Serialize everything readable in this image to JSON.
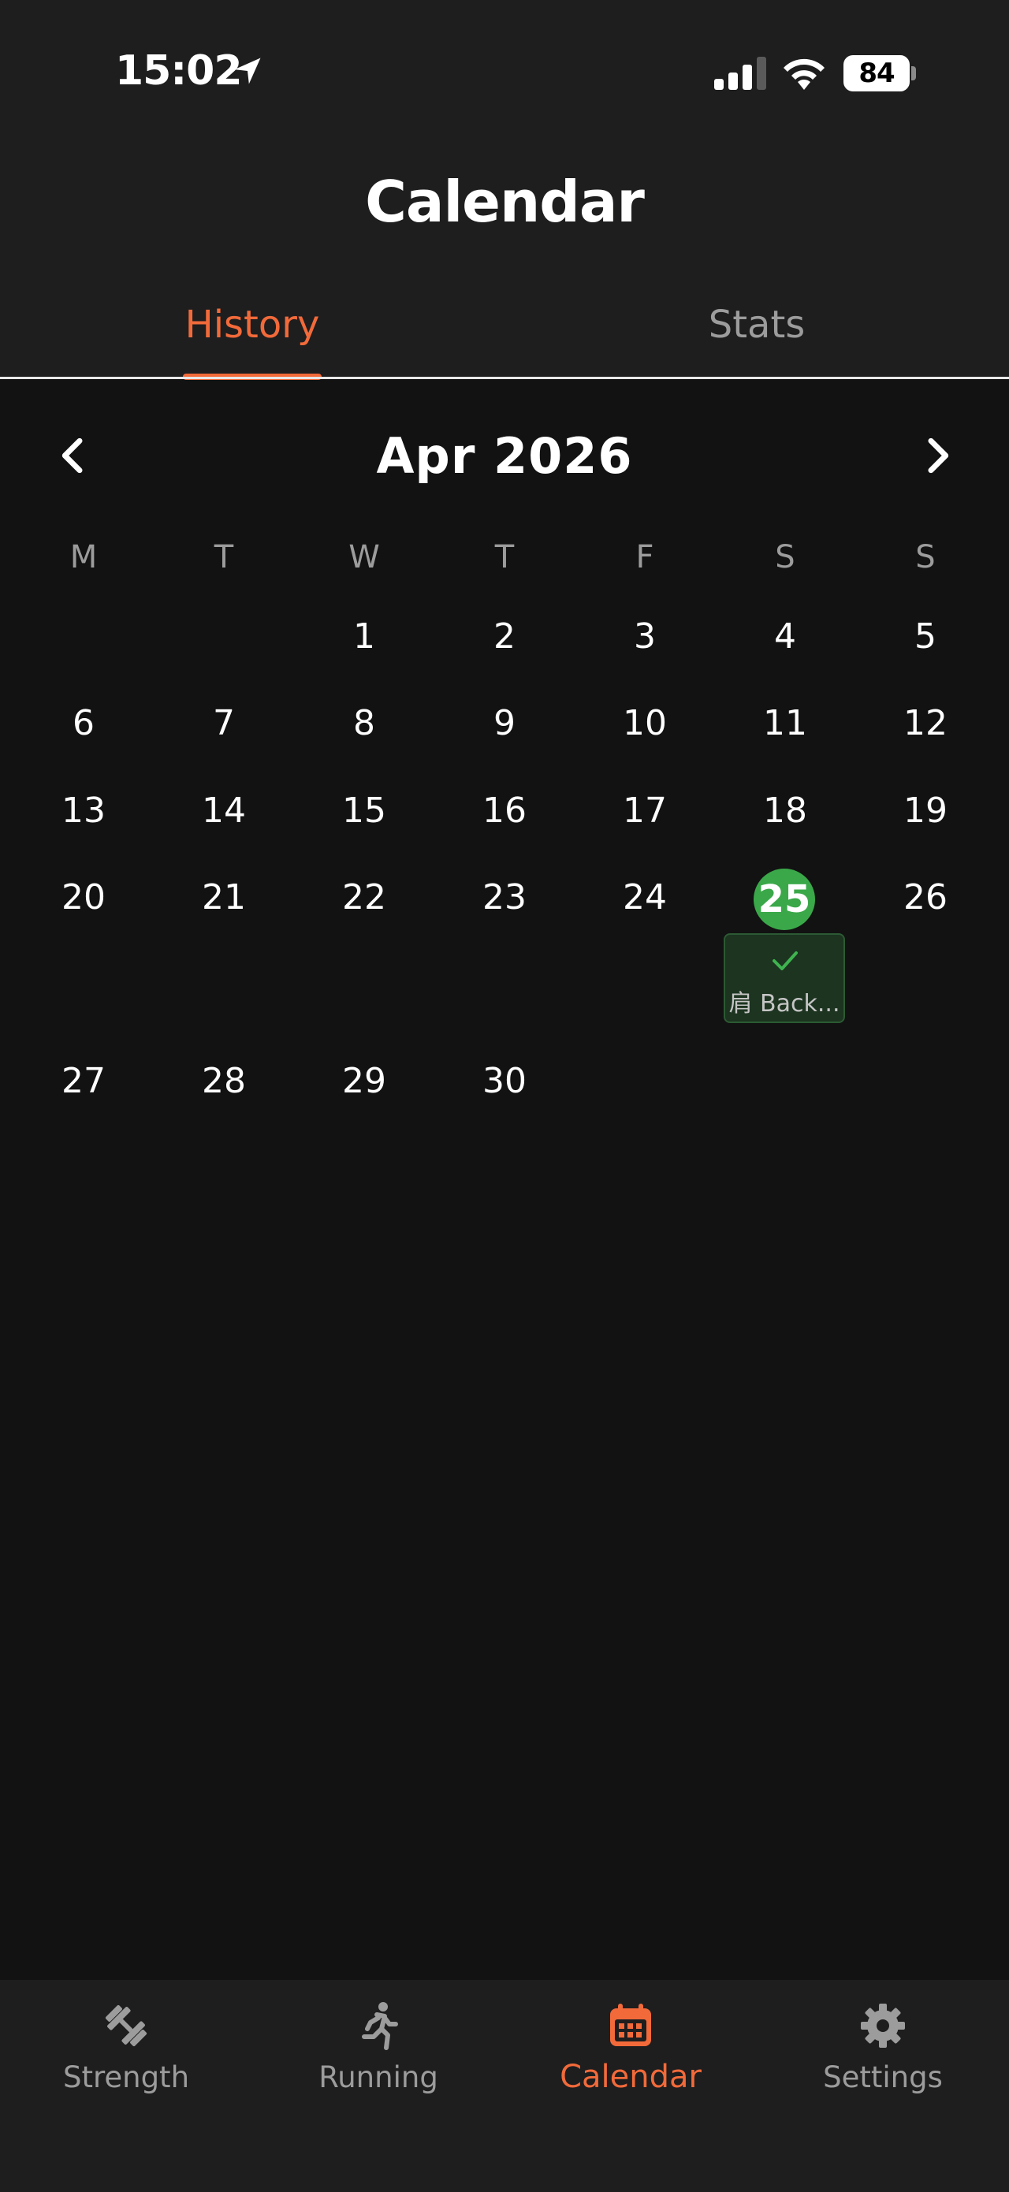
{
  "status_bar": {
    "time": "15:02",
    "battery": "84"
  },
  "header": {
    "title": "Calendar"
  },
  "tabs": [
    {
      "label": "History",
      "active": true
    },
    {
      "label": "Stats",
      "active": false
    }
  ],
  "calendar": {
    "month_label": "Apr 2026",
    "weekdays": [
      "M",
      "T",
      "W",
      "T",
      "F",
      "S",
      "S"
    ],
    "days": [
      "1",
      "2",
      "3",
      "4",
      "5",
      "6",
      "7",
      "8",
      "9",
      "10",
      "11",
      "12",
      "13",
      "14",
      "15",
      "16",
      "17",
      "18",
      "19",
      "20",
      "21",
      "22",
      "23",
      "24",
      "25",
      "26",
      "27",
      "28",
      "29",
      "30"
    ],
    "today": "25",
    "workout": {
      "label": "肩 Back..."
    }
  },
  "bottom_nav": [
    {
      "label": "Strength",
      "icon": "dumbbell-icon",
      "active": false
    },
    {
      "label": "Running",
      "icon": "running-icon",
      "active": false
    },
    {
      "label": "Calendar",
      "icon": "calendar-icon",
      "active": true
    },
    {
      "label": "Settings",
      "icon": "gear-icon",
      "active": false
    }
  ],
  "colors": {
    "accent": "#f26a3a",
    "today": "#3aa849",
    "background": "#121212",
    "header": "#1e1e1f"
  }
}
